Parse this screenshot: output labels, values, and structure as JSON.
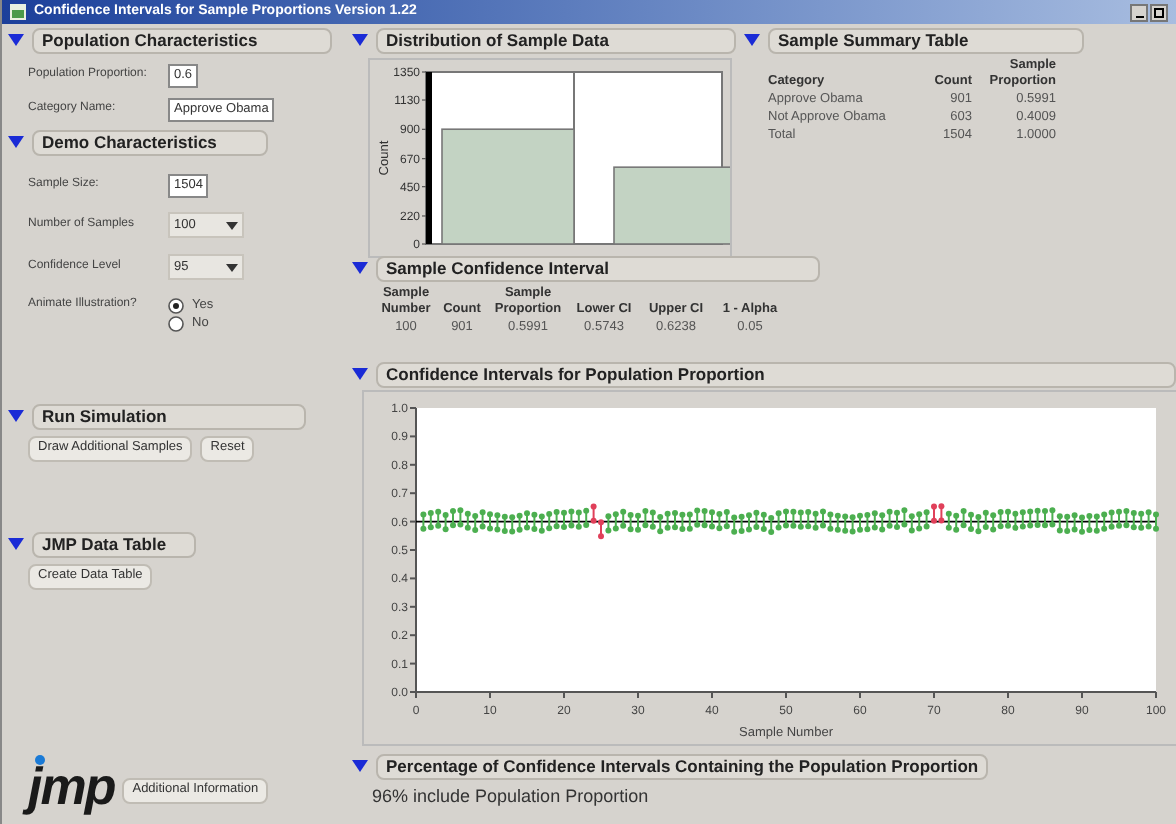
{
  "window": {
    "title": "Confidence Intervals for Sample Proportions Version 1.22"
  },
  "population": {
    "title": "Population Characteristics",
    "expanded": true,
    "items": [
      {
        "kind": "field",
        "label": "Population Proportion:",
        "value": "0.6"
      },
      {
        "kind": "field",
        "label": "Category Name:",
        "value": "Approve Obama"
      }
    ]
  },
  "demo": {
    "title": "Demo Characteristics",
    "expanded": true,
    "items": [
      {
        "kind": "field",
        "label": "Sample Size:",
        "value": "1504"
      },
      {
        "kind": "dropdown",
        "label": "Number of Samples",
        "value": "100"
      },
      {
        "kind": "dropdown",
        "label": "Confidence Level",
        "value": "95"
      },
      {
        "kind": "radio",
        "label": "Animate Illustration?",
        "options": [
          {
            "label": "Yes",
            "selected": true
          },
          {
            "label": "No",
            "selected": false
          }
        ]
      }
    ]
  },
  "run_simulation": {
    "title": "Run Simulation",
    "expanded": true,
    "buttons": [
      "Draw Additional Samples",
      "Reset"
    ]
  },
  "data_table": {
    "title": "JMP Data Table",
    "expanded": true,
    "buttons": [
      "Create Data Table"
    ]
  },
  "logo": "jmp",
  "info_button": "Additional Information",
  "distribution": {
    "title": "Distribution of Sample Data",
    "expanded": true,
    "chart_data": {
      "type": "bar",
      "ylabel": "Count",
      "categories": [
        null,
        null
      ],
      "ylim": [
        0,
        1350
      ],
      "yticks": [
        0,
        220,
        450,
        670,
        900,
        1130,
        1350
      ],
      "series": [
        {
          "color": "#c3d3c3",
          "values": [
            901,
            603
          ]
        }
      ]
    }
  },
  "summary": {
    "title": "Sample Summary Table",
    "expanded": true,
    "columns": [
      "Category",
      "Count",
      "Sample Proportion"
    ],
    "rows": [
      [
        "Approve Obama",
        "901",
        "0.5991"
      ],
      [
        "Not Approve Obama",
        "603",
        "0.4009"
      ],
      [
        "Total",
        "1504",
        "1.0000"
      ]
    ]
  },
  "sample_ci": {
    "title": "Sample Confidence Interval",
    "expanded": true,
    "columns": [
      "Sample Number",
      "Count",
      "Sample Proportion",
      "Lower CI",
      "Upper CI",
      "1 - Alpha"
    ],
    "rows": [
      [
        "100",
        "901",
        "0.5991",
        "0.5743",
        "0.6238",
        "0.05"
      ]
    ]
  },
  "ci_chart": {
    "title": "Confidence Intervals for Population Proportion",
    "expanded": true,
    "chart_data": {
      "type": "scatter",
      "xlabel": "Sample Number",
      "x": [
        1,
        2,
        3,
        4,
        5,
        6,
        7,
        8,
        9,
        10,
        11,
        12,
        13,
        14,
        15,
        16,
        17,
        18,
        19,
        20,
        21,
        22,
        23,
        24,
        25,
        26,
        27,
        28,
        29,
        30,
        31,
        32,
        33,
        34,
        35,
        36,
        37,
        38,
        39,
        40,
        41,
        42,
        43,
        44,
        45,
        46,
        47,
        48,
        49,
        50,
        51,
        52,
        53,
        54,
        55,
        56,
        57,
        58,
        59,
        60,
        61,
        62,
        63,
        64,
        65,
        66,
        67,
        68,
        69,
        70,
        71,
        72,
        73,
        74,
        75,
        76,
        77,
        78,
        79,
        80,
        81,
        82,
        83,
        84,
        85,
        86,
        87,
        88,
        89,
        90,
        91,
        92,
        93,
        94,
        95,
        96,
        97,
        98,
        99,
        100
      ],
      "xlim": [
        0,
        100
      ],
      "ylim": [
        0,
        1
      ],
      "xticks": [
        0,
        10,
        20,
        30,
        40,
        50,
        60,
        70,
        80,
        90,
        100
      ],
      "yticks": [
        {
          "value": 0,
          "label": "0.0"
        },
        {
          "value": 0.1,
          "label": "0.1"
        },
        {
          "value": 0.2,
          "label": "0.2"
        },
        {
          "value": 0.3,
          "label": "0.3"
        },
        {
          "value": 0.4,
          "label": "0.4"
        },
        {
          "value": 0.5,
          "label": "0.5"
        },
        {
          "value": 0.6,
          "label": "0.6"
        },
        {
          "value": 0.7,
          "label": "0.7"
        },
        {
          "value": 0.8,
          "label": "0.8"
        },
        {
          "value": 0.9,
          "label": "0.9"
        },
        {
          "value": 1,
          "label": "1.0"
        }
      ],
      "series": [
        {
          "color": "#4caf50",
          "values": [
            0.575,
            0.58,
            0.585,
            0.573,
            0.587,
            0.59,
            0.578,
            0.57,
            0.583,
            0.576,
            0.572,
            0.567,
            0.565,
            0.571,
            0.579,
            0.574,
            0.568,
            0.577,
            0.584,
            0.581,
            0.586,
            0.582,
            0.588,
            null,
            null,
            0.569,
            0.576,
            0.585,
            0.573,
            0.571,
            0.587,
            0.582,
            0.566,
            0.578,
            0.58,
            0.574,
            0.575,
            0.589,
            0.587,
            0.583,
            0.577,
            0.584,
            0.564,
            0.567,
            0.572,
            0.581,
            0.574,
            0.563,
            0.579,
            0.586,
            0.585,
            0.582,
            0.584,
            0.578,
            0.586,
            0.575,
            0.571,
            0.568,
            0.565,
            0.571,
            0.573,
            0.579,
            0.572,
            0.585,
            0.581,
            0.59,
            0.569,
            0.576,
            0.583,
            null,
            null,
            0.578,
            0.571,
            0.587,
            0.574,
            0.566,
            0.581,
            0.572,
            0.584,
            0.585,
            0.578,
            0.583,
            0.586,
            0.588,
            0.587,
            0.59,
            0.569,
            0.567,
            0.572,
            0.564,
            0.57,
            0.568,
            0.575,
            0.582,
            0.585,
            0.587,
            0.58,
            0.578,
            0.583,
            0.575
          ]
        },
        {
          "color": "#4caf50",
          "values": [
            0.625,
            0.63,
            0.635,
            0.623,
            0.637,
            0.64,
            0.628,
            0.62,
            0.633,
            0.626,
            0.622,
            0.617,
            0.615,
            0.621,
            0.629,
            0.624,
            0.618,
            0.627,
            0.634,
            0.631,
            0.636,
            0.632,
            0.638,
            null,
            null,
            0.619,
            0.626,
            0.635,
            0.623,
            0.621,
            0.637,
            0.632,
            0.616,
            0.628,
            0.63,
            0.624,
            0.625,
            0.639,
            0.637,
            0.633,
            0.627,
            0.634,
            0.614,
            0.617,
            0.622,
            0.631,
            0.624,
            0.613,
            0.629,
            0.636,
            0.635,
            0.632,
            0.634,
            0.628,
            0.636,
            0.625,
            0.621,
            0.618,
            0.615,
            0.621,
            0.623,
            0.629,
            0.622,
            0.635,
            0.631,
            0.64,
            0.619,
            0.626,
            0.633,
            null,
            null,
            0.628,
            0.621,
            0.637,
            0.624,
            0.616,
            0.631,
            0.622,
            0.634,
            0.635,
            0.628,
            0.633,
            0.636,
            0.638,
            0.637,
            0.64,
            0.619,
            0.617,
            0.622,
            0.614,
            0.62,
            0.618,
            0.625,
            0.632,
            0.635,
            0.637,
            0.63,
            0.628,
            0.633,
            0.625
          ]
        },
        {
          "color": "#e0405a",
          "values": [
            null,
            null,
            null,
            null,
            null,
            null,
            null,
            null,
            null,
            null,
            null,
            null,
            null,
            null,
            null,
            null,
            null,
            null,
            null,
            null,
            null,
            null,
            null,
            0.603,
            0.548,
            null,
            null,
            null,
            null,
            null,
            null,
            null,
            null,
            null,
            null,
            null,
            null,
            null,
            null,
            null,
            null,
            null,
            null,
            null,
            null,
            null,
            null,
            null,
            null,
            null,
            null,
            null,
            null,
            null,
            null,
            null,
            null,
            null,
            null,
            null,
            null,
            null,
            null,
            null,
            null,
            null,
            null,
            null,
            null,
            0.603,
            0.604,
            null,
            null,
            null,
            null,
            null,
            null,
            null,
            null,
            null,
            null,
            null,
            null,
            null,
            null,
            null,
            null,
            null,
            null,
            null,
            null,
            null,
            null,
            null,
            null,
            null,
            null,
            null,
            null,
            null
          ]
        },
        {
          "color": "#e0405a",
          "values": [
            null,
            null,
            null,
            null,
            null,
            null,
            null,
            null,
            null,
            null,
            null,
            null,
            null,
            null,
            null,
            null,
            null,
            null,
            null,
            null,
            null,
            null,
            null,
            0.653,
            0.598,
            null,
            null,
            null,
            null,
            null,
            null,
            null,
            null,
            null,
            null,
            null,
            null,
            null,
            null,
            null,
            null,
            null,
            null,
            null,
            null,
            null,
            null,
            null,
            null,
            null,
            null,
            null,
            null,
            null,
            null,
            null,
            null,
            null,
            null,
            null,
            null,
            null,
            null,
            null,
            null,
            null,
            null,
            null,
            null,
            0.653,
            0.654,
            null,
            null,
            null,
            null,
            null,
            null,
            null,
            null,
            null,
            null,
            null,
            null,
            null,
            null,
            null,
            null,
            null,
            null,
            null,
            null,
            null,
            null,
            null,
            null,
            null,
            null,
            null,
            null,
            null
          ]
        }
      ]
    }
  },
  "coverage": {
    "title": "Percentage of Confidence Intervals Containing the Population Proportion",
    "expanded": true,
    "text": "96% include Population Proportion"
  }
}
